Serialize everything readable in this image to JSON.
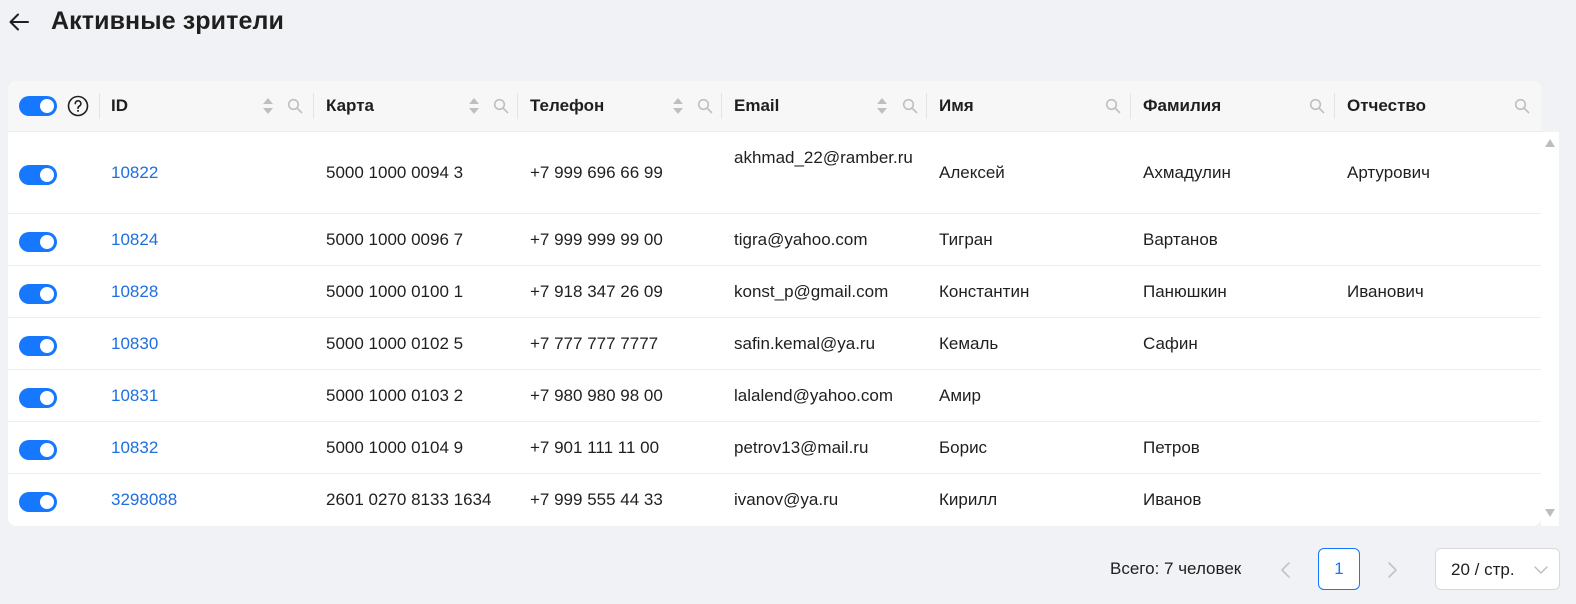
{
  "page": {
    "title": "Активные зрители"
  },
  "table": {
    "columns": [
      {
        "key": "id",
        "label": "ID"
      },
      {
        "key": "card",
        "label": "Карта"
      },
      {
        "key": "phone",
        "label": "Телефон"
      },
      {
        "key": "email",
        "label": "Email"
      },
      {
        "key": "first_name",
        "label": "Имя"
      },
      {
        "key": "last_name",
        "label": "Фамилия"
      },
      {
        "key": "patronymic",
        "label": "Отчество"
      }
    ],
    "rows": [
      {
        "active": true,
        "id": "10822",
        "card": "5000 1000 0094 3",
        "phone": "+7 999 696 66 99",
        "email": "akhmad_22@ramber.ru",
        "first_name": "Алексей",
        "last_name": "Ахмадулин",
        "patronymic": "Артурович"
      },
      {
        "active": true,
        "id": "10824",
        "card": "5000 1000 0096 7",
        "phone": "+7 999 999 99 00",
        "email": "tigra@yahoo.com",
        "first_name": "Тигран",
        "last_name": "Вартанов",
        "patronymic": ""
      },
      {
        "active": true,
        "id": "10828",
        "card": "5000 1000 0100 1",
        "phone": "+7 918 347 26 09",
        "email": "konst_p@gmail.com",
        "first_name": "Константин",
        "last_name": "Панюшкин",
        "patronymic": "Иванович"
      },
      {
        "active": true,
        "id": "10830",
        "card": "5000 1000 0102 5",
        "phone": "+7 777 777 7777",
        "email": "safin.kemal@ya.ru",
        "first_name": "Кемаль",
        "last_name": "Сафин",
        "patronymic": ""
      },
      {
        "active": true,
        "id": "10831",
        "card": "5000 1000 0103 2",
        "phone": "+7 980 980 98 00",
        "email": "lalalend@yahoo.com",
        "first_name": "Амир",
        "last_name": "",
        "patronymic": ""
      },
      {
        "active": true,
        "id": "10832",
        "card": "5000 1000 0104 9",
        "phone": "+7 901 111 11 00",
        "email": "petrov13@mail.ru",
        "first_name": "Борис",
        "last_name": "Петров",
        "patronymic": ""
      },
      {
        "active": true,
        "id": "3298088",
        "card": "2601 0270 8133 1634",
        "phone": "+7 999 555 44 33",
        "email": "ivanov@ya.ru",
        "first_name": "Кирилл",
        "last_name": "Иванов",
        "patronymic": ""
      }
    ]
  },
  "pagination": {
    "total_text": "Всего: 7 человек",
    "current_page": "1",
    "page_size": "20 / стр."
  },
  "colors": {
    "accent": "#1677ff",
    "link": "#1f6fe0",
    "background": "#f1f2f5"
  }
}
